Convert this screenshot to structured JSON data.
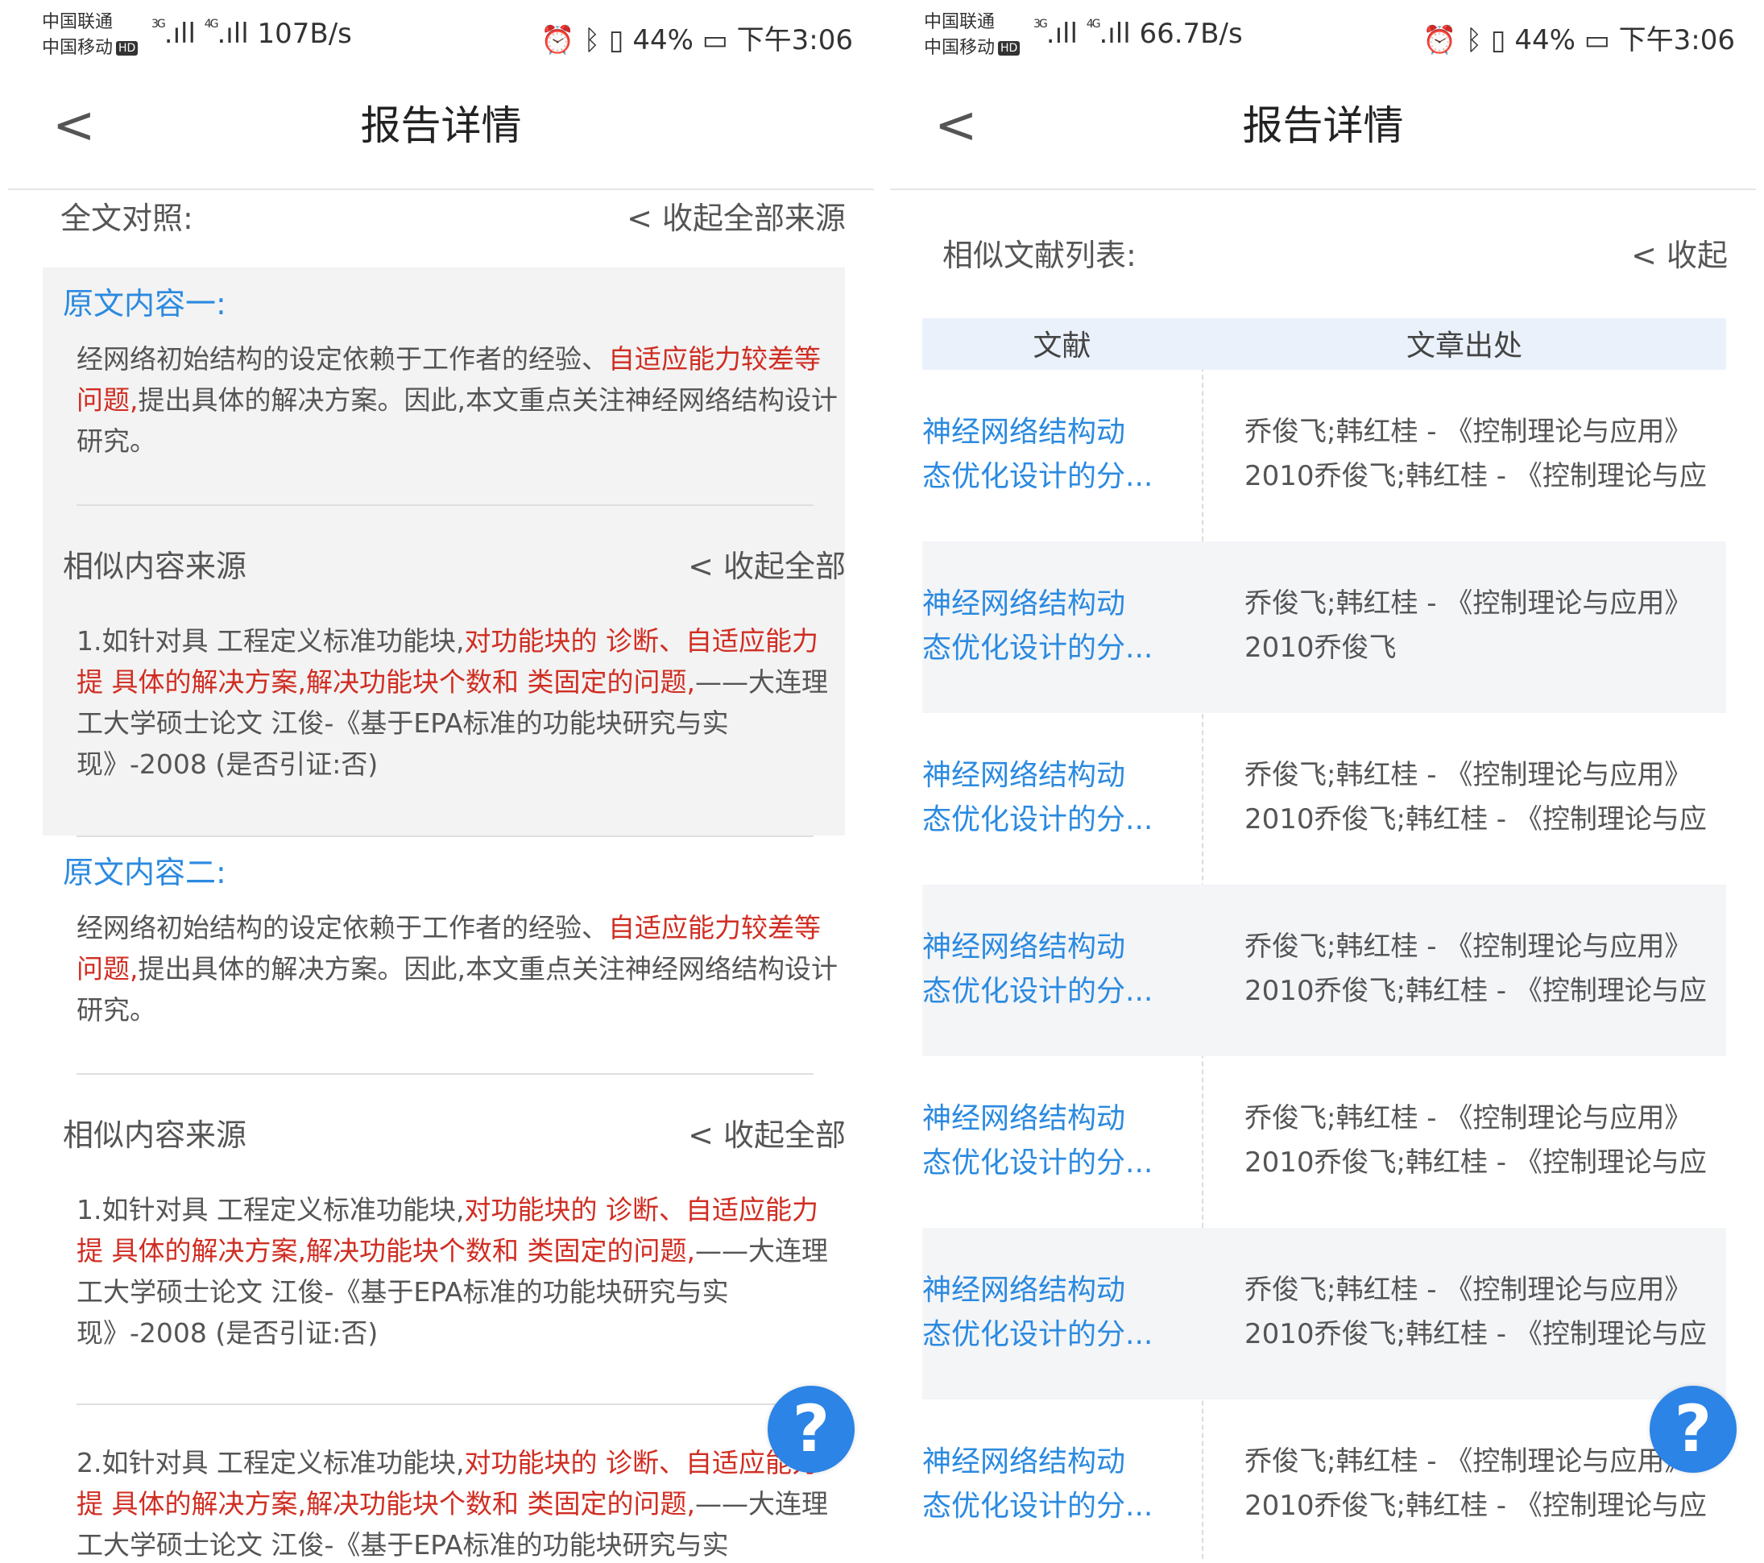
{
  "left": {
    "status": {
      "carrier1": "中国联通",
      "carrier2": "中国移动",
      "hd": "HD",
      "net1": "3G",
      "net2": "4G",
      "speed": "107B/s",
      "battery": "44%",
      "time": "下午3:06"
    },
    "nav": {
      "back": "<",
      "title": "报告详情"
    },
    "header": {
      "label": "全文对照:",
      "collapse": "< 收起全部来源"
    },
    "block1": {
      "title": "原文内容一:",
      "text_pre": "经网络初始结构的设定依赖于工作者的经验、",
      "text_red": "自适应能力较差等问题,",
      "text_post": "提出具体的解决方案。因此,本文重点关注神经网络结构设计研究。"
    },
    "similar1": {
      "label": "相似内容来源",
      "collapse": "< 收起全部"
    },
    "source1": {
      "pre": "1.如针对具 工程定义标准功能块,",
      "red": "对功能块的 诊断、自适应能力提 具体的解决方案,解决功能块个数和 类固定的问题,",
      "post": "——大连理工大学硕士论文 江俊-《基于EPA标准的功能块研究与实现》-2008 (是否引证:否)"
    },
    "block2": {
      "title": "原文内容二:",
      "text_pre": "经网络初始结构的设定依赖于工作者的经验、",
      "text_red": "自适应能力较差等问题,",
      "text_post": "提出具体的解决方案。因此,本文重点关注神经网络结构设计研究。"
    },
    "similar2": {
      "label": "相似内容来源",
      "collapse": "< 收起全部"
    },
    "source2": {
      "pre": "1.如针对具 工程定义标准功能块,",
      "red": "对功能块的 诊断、自适应能力提 具体的解决方案,解决功能块个数和 类固定的问题,",
      "post": "——大连理工大学硕士论文 江俊-《基于EPA标准的功能块研究与实现》-2008 (是否引证:否)"
    },
    "source3": {
      "pre": "2.如针对具 工程定义标准功能块,",
      "red": "对功能块的 诊断、自适应能力提 具体的解决方案,解决功能块个数和 类固定的问题,",
      "post": "——大连理工大学硕士论文 江俊-《基于EPA标准的功能块研究与实"
    },
    "help": "?"
  },
  "right": {
    "status": {
      "carrier1": "中国联通",
      "carrier2": "中国移动",
      "hd": "HD",
      "net1": "3G",
      "net2": "4G",
      "speed": "66.7B/s",
      "battery": "44%",
      "time": "下午3:06"
    },
    "nav": {
      "back": "<",
      "title": "报告详情"
    },
    "header": {
      "label": "相似文献列表:",
      "collapse": "< 收起"
    },
    "table": {
      "col1": "文献",
      "col2": "文章出处",
      "rows": [
        {
          "doc1": "神经网络结构动",
          "doc2": "态优化设计的分...",
          "src1": "乔俊飞;韩红桂 - 《控制理论与应用》",
          "src2": "2010乔俊飞;韩红桂 - 《控制理论与应"
        },
        {
          "doc1": "神经网络结构动",
          "doc2": "态优化设计的分...",
          "src1": "乔俊飞;韩红桂 - 《控制理论与应用》",
          "src2": "2010乔俊飞"
        },
        {
          "doc1": "神经网络结构动",
          "doc2": "态优化设计的分...",
          "src1": "乔俊飞;韩红桂 - 《控制理论与应用》",
          "src2": "2010乔俊飞;韩红桂 - 《控制理论与应"
        },
        {
          "doc1": "神经网络结构动",
          "doc2": "态优化设计的分...",
          "src1": "乔俊飞;韩红桂 - 《控制理论与应用》",
          "src2": "2010乔俊飞;韩红桂 - 《控制理论与应"
        },
        {
          "doc1": "神经网络结构动",
          "doc2": "态优化设计的分...",
          "src1": "乔俊飞;韩红桂 - 《控制理论与应用》",
          "src2": "2010乔俊飞;韩红桂 - 《控制理论与应"
        },
        {
          "doc1": "神经网络结构动",
          "doc2": "态优化设计的分...",
          "src1": "乔俊飞;韩红桂 - 《控制理论与应用》",
          "src2": "2010乔俊飞;韩红桂 - 《控制理论与应"
        },
        {
          "doc1": "神经网络结构动",
          "doc2": "态优化设计的分...",
          "src1": "乔俊飞;韩红桂 - 《控制理论与应用》",
          "src2": "2010乔俊飞;韩红桂 - 《控制理论与应"
        }
      ]
    },
    "help": "?"
  }
}
